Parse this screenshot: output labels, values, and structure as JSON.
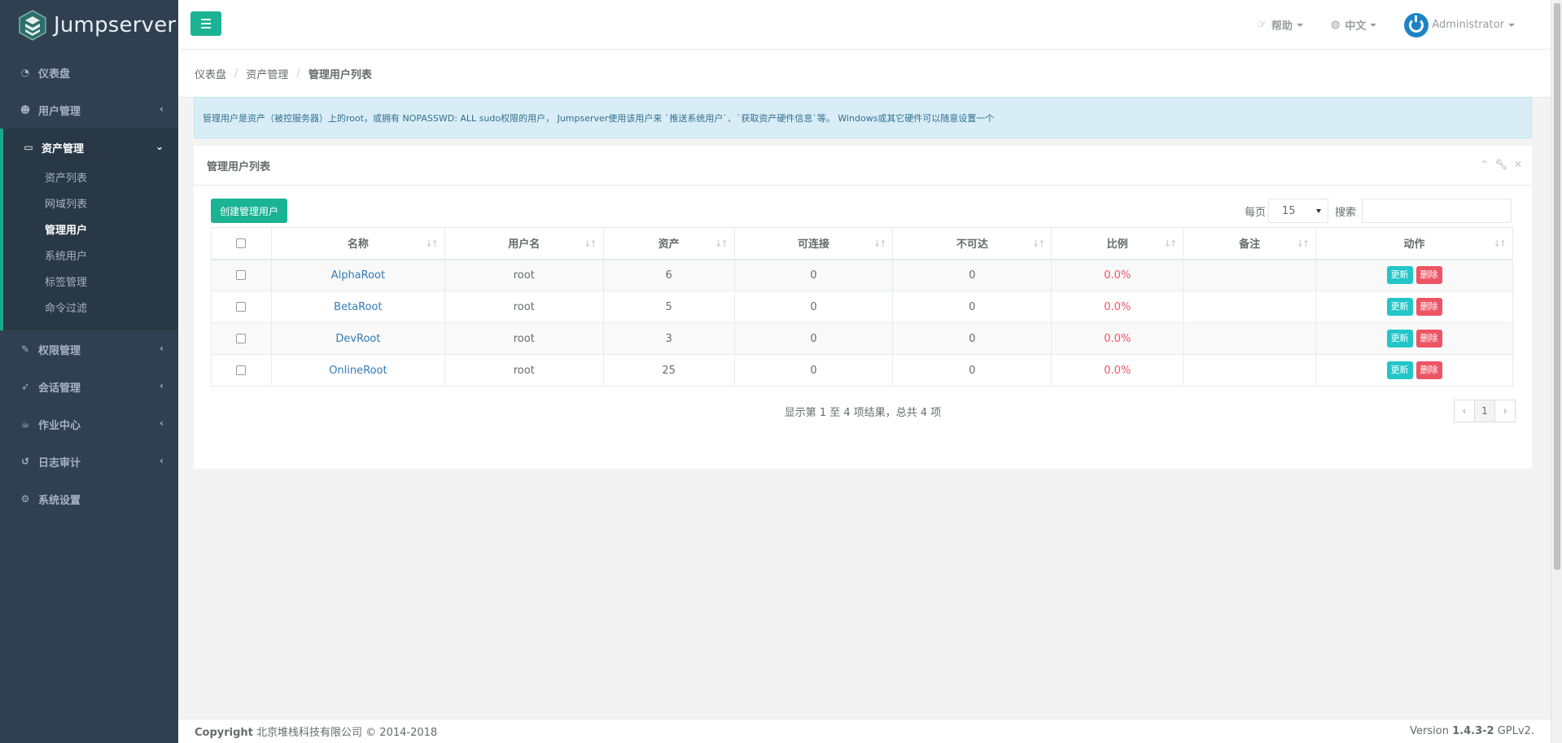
{
  "app": {
    "logo_text": "Jumpserver"
  },
  "sidebar": {
    "items": [
      {
        "label": "仪表盘",
        "icon": "dashboard-icon"
      },
      {
        "label": "用户管理",
        "icon": "users-icon"
      },
      {
        "label": "资产管理",
        "icon": "inbox-icon"
      },
      {
        "label": "权限管理",
        "icon": "edit-icon"
      },
      {
        "label": "会话管理",
        "icon": "rocket-icon"
      },
      {
        "label": "作业中心",
        "icon": "coffee-icon"
      },
      {
        "label": "日志审计",
        "icon": "history-icon"
      },
      {
        "label": "系统设置",
        "icon": "gears-icon"
      }
    ],
    "subitems": [
      "资产列表",
      "网域列表",
      "管理用户",
      "系统用户",
      "标签管理",
      "命令过滤"
    ],
    "current_sub": "管理用户"
  },
  "topbar": {
    "help": "帮助",
    "lang": "中文",
    "user": "Administrator"
  },
  "breadcrumb": [
    "仪表盘",
    "资产管理",
    "管理用户列表"
  ],
  "alert": "管理用户是资产（被控服务器）上的root，或拥有 NOPASSWD: ALL sudo权限的用户， Jumpserver使用该用户来 `推送系统用户`、`获取资产硬件信息`等。 Windows或其它硬件可以随意设置一个",
  "panel": {
    "title": "管理用户列表",
    "create_button": "创建管理用户",
    "per_page_label": "每页",
    "per_page_value": "15",
    "search_label": "搜索",
    "search_value": ""
  },
  "table": {
    "columns": [
      "名称",
      "用户名",
      "资产",
      "可连接",
      "不可达",
      "比例",
      "备注",
      "动作"
    ],
    "rows": [
      {
        "name": "AlphaRoot",
        "username": "root",
        "assets": "6",
        "connectable": "0",
        "unreachable": "0",
        "ratio": "0.0%",
        "comment": ""
      },
      {
        "name": "BetaRoot",
        "username": "root",
        "assets": "5",
        "connectable": "0",
        "unreachable": "0",
        "ratio": "0.0%",
        "comment": ""
      },
      {
        "name": "DevRoot",
        "username": "root",
        "assets": "3",
        "connectable": "0",
        "unreachable": "0",
        "ratio": "0.0%",
        "comment": ""
      },
      {
        "name": "OnlineRoot",
        "username": "root",
        "assets": "25",
        "connectable": "0",
        "unreachable": "0",
        "ratio": "0.0%",
        "comment": ""
      }
    ],
    "update_label": "更新",
    "delete_label": "删除"
  },
  "pagination": {
    "summary": "显示第 1 至 4 项结果，总共 4 项",
    "prev": "‹",
    "page": "1",
    "next": "›"
  },
  "footer": {
    "copyright_bold": "Copyright",
    "copyright_rest": "北京堆栈科技有限公司 © 2014-2018",
    "version_prefix": "Version",
    "version_bold": "1.4.3-2",
    "version_suffix": "GPLv2."
  },
  "colors": {
    "accent": "#1ab394",
    "sidebar": "#2f4050",
    "danger": "#ed5565",
    "info": "#23c6c8"
  }
}
